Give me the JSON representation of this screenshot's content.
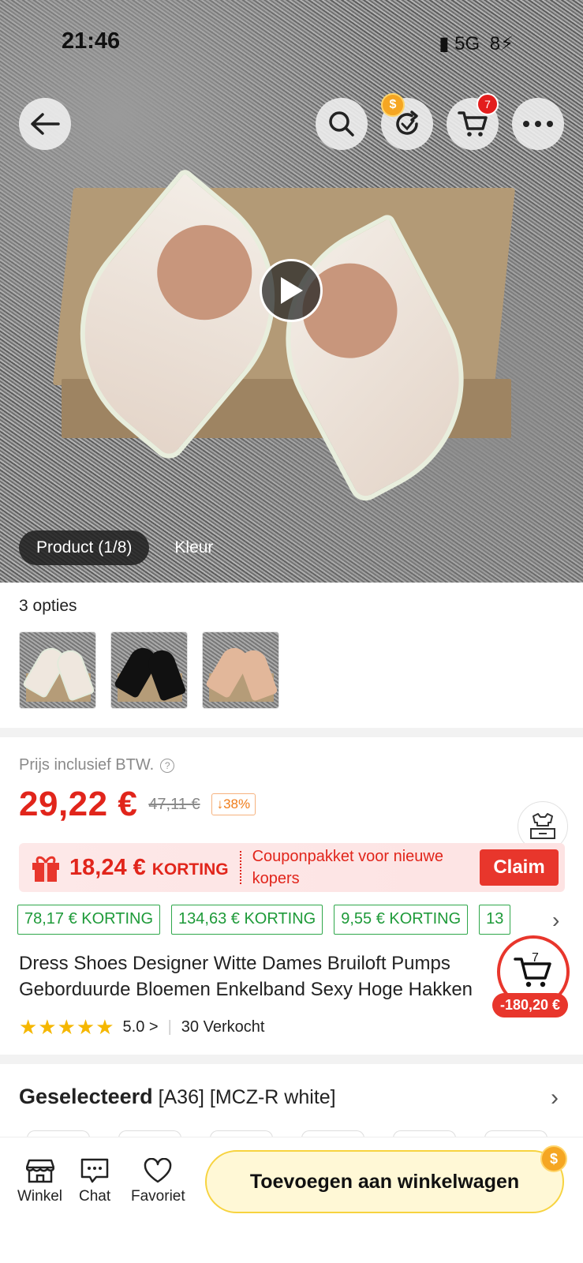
{
  "status_bar": {
    "time": "21:46",
    "network": "5G",
    "battery": "8"
  },
  "header": {
    "cart_count": "7",
    "coin_symbol": "$"
  },
  "hero": {
    "tabs": [
      {
        "label": "Product (1/8)",
        "active": true
      },
      {
        "label": "Kleur",
        "active": false
      }
    ]
  },
  "options": {
    "label": "3 opties",
    "thumbnails": [
      {
        "color": "white"
      },
      {
        "color": "black"
      },
      {
        "color": "nude"
      }
    ]
  },
  "pricing": {
    "note": "Prijs inclusief BTW.",
    "price": "29,22 €",
    "old_price": "47,11 €",
    "discount": "↓38%"
  },
  "coupon": {
    "amount": "18,24 €",
    "off_label": "KORTING",
    "text": "Couponpakket voor nieuwe kopers",
    "claim_label": "Claim"
  },
  "discount_chips": [
    "78,17 € KORTING",
    "134,63 € KORTING",
    "9,55 € KORTING",
    "13"
  ],
  "product": {
    "title_line1": "Dress Shoes Designer Witte Dames Bruiloft Pumps",
    "title_line2": "Geborduurde Bloemen Enkelband Sexy Hoge Hakken",
    "stars": "★★★★★",
    "rating": "5.0 >",
    "sold": "30 Verkocht"
  },
  "floating_cart": {
    "count": "7",
    "savings": "-180,20 €"
  },
  "selected": {
    "label": "Geselecteerd",
    "value": "[A36] [MCZ-R white]"
  },
  "bottom_bar": {
    "store_label": "Winkel",
    "chat_label": "Chat",
    "favorite_label": "Favoriet",
    "add_to_cart_label": "Toevoegen aan winkelwagen"
  },
  "colors": {
    "accent_red": "#e1251b",
    "green": "#1e9a39",
    "yellow": "#f7d33f"
  }
}
